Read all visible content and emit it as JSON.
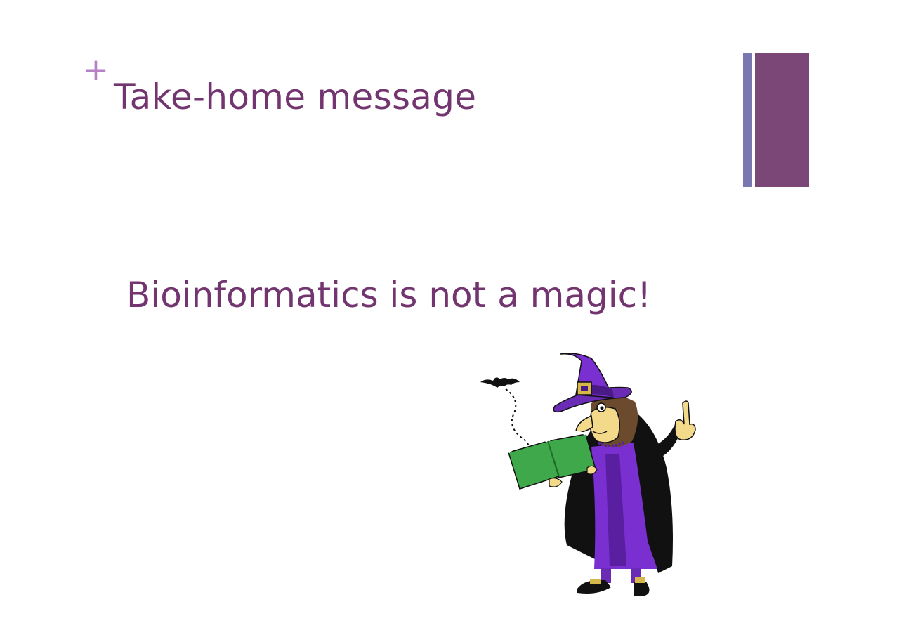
{
  "slide": {
    "plus_mark": "+",
    "title": "Take-home message",
    "message": "Bioinformatics is not a magic!"
  },
  "colors": {
    "title": "#73356f",
    "plus": "#b77fc6",
    "accent_thin": "#7a76b0",
    "accent_thick": "#7a4777",
    "witch_hat": "#6a2bb5",
    "witch_dress": "#7a2fd0",
    "book": "#3fa84a"
  },
  "illustration": {
    "name": "witch-reading-book-clipart"
  }
}
